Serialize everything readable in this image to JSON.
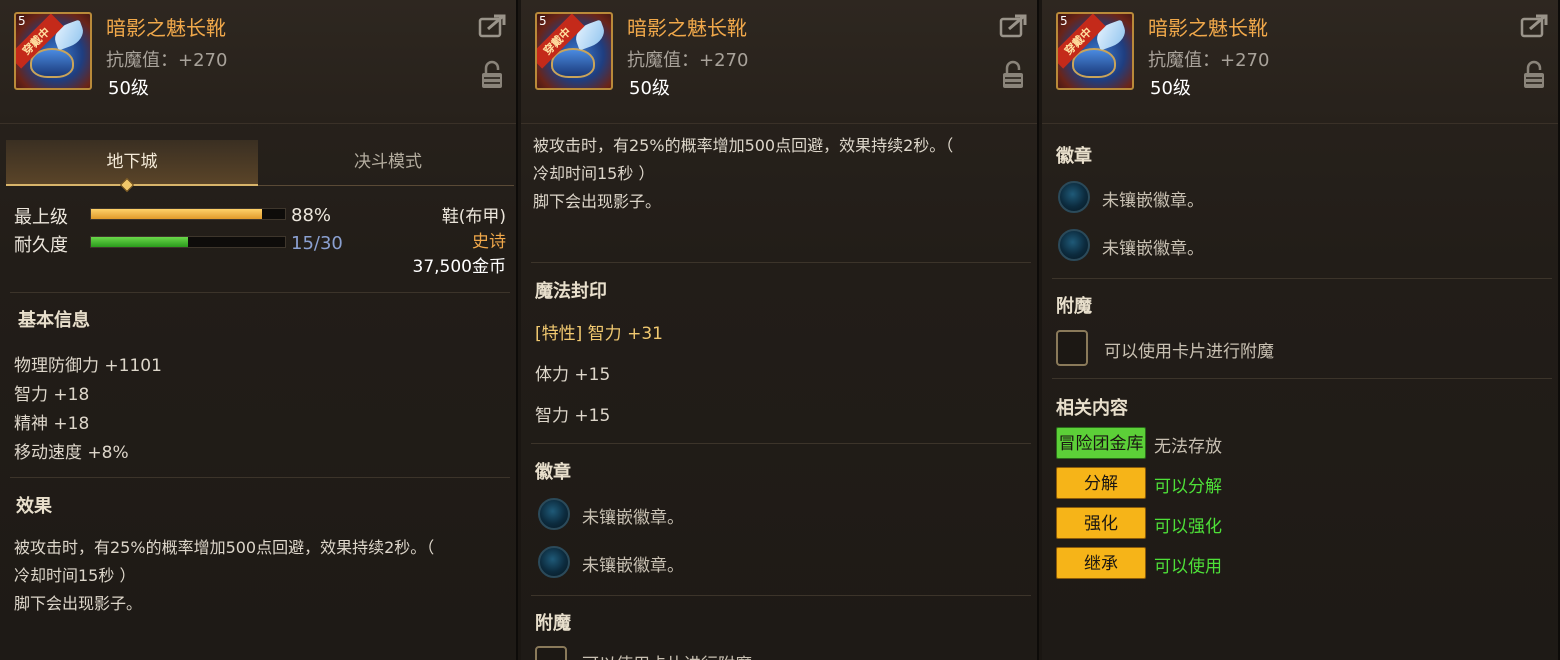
{
  "item": {
    "name": "暗影之魅长靴",
    "stat_line": "抗魔值：+270",
    "level": "50级",
    "level_tag": "5",
    "wearing_badge": "穿戴中"
  },
  "icons": {
    "share": "share-icon",
    "lock": "lock-icon"
  },
  "colors": {
    "item_name": "#f0a84a",
    "rarity_epic": "#f0a84a",
    "durability_text": "#8aa0d0",
    "bar_orange": "#e09a2a",
    "bar_green": "#2a9a1c",
    "badge_green": "#5cd038",
    "badge_yellow": "#f6b418",
    "text_green": "#4ee038"
  },
  "panel1": {
    "tabs": [
      {
        "label": "地下城",
        "active": true
      },
      {
        "label": "决斗模式",
        "active": false
      }
    ],
    "max_level": {
      "label": "最上级",
      "value_text": "88%",
      "fraction": 0.88
    },
    "durability": {
      "label": "耐久度",
      "value_text": "15/30",
      "fraction": 0.5
    },
    "item_type": "鞋(布甲)",
    "rarity": "史诗",
    "price": "37,500金币",
    "basic_info": {
      "title": "基本信息",
      "stats": [
        "物理防御力 +1101",
        "智力 +18",
        "精神 +18",
        "移动速度 +8%"
      ]
    },
    "effect": {
      "title": "效果",
      "lines": [
        "被攻击时，有25%的概率增加500点回避，效果持续2秒。（",
        "冷却时间15秒 ）",
        "脚下会出现影子。"
      ]
    }
  },
  "panel2": {
    "effect_lines": [
      "被攻击时，有25%的概率增加500点回避，效果持续2秒。（",
      "冷却时间15秒 ）",
      "脚下会出现影子。"
    ],
    "magic_seal": {
      "title": "魔法封印",
      "lines": [
        "[特性] 智力 +31",
        "体力 +15",
        "智力 +15"
      ]
    },
    "emblem": {
      "title": "徽章",
      "slots": [
        "未镶嵌徽章。",
        "未镶嵌徽章。"
      ]
    },
    "enchant": {
      "title": "附魔",
      "text": "可以使用卡片进行附魔"
    }
  },
  "panel3": {
    "emblem": {
      "title": "徽章",
      "slots": [
        "未镶嵌徽章。",
        "未镶嵌徽章。"
      ]
    },
    "enchant": {
      "title": "附魔",
      "text": "可以使用卡片进行附魔"
    },
    "related": {
      "title": "相关内容",
      "rows": [
        {
          "badge": "冒险团金库",
          "text": "无法存放"
        },
        {
          "badge": "分解",
          "text": "可以分解"
        },
        {
          "badge": "强化",
          "text": "可以强化"
        },
        {
          "badge": "继承",
          "text": "可以使用"
        }
      ]
    }
  }
}
